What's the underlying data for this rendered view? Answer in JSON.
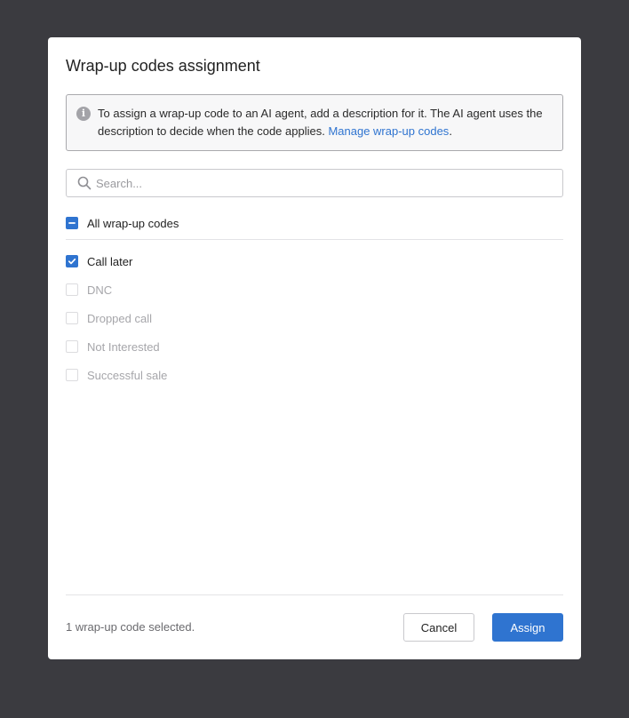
{
  "dialog": {
    "title": "Wrap-up codes assignment",
    "info": {
      "text": "To assign a wrap-up code to an AI agent, add a description for it. The AI agent uses the description to decide when the code applies. ",
      "link_label": "Manage wrap-up codes",
      "suffix": "."
    },
    "search": {
      "placeholder": "Search...",
      "value": ""
    },
    "select_all": {
      "label": "All wrap-up codes",
      "state": "indeterminate"
    },
    "codes": [
      {
        "label": "Call later",
        "checked": true,
        "enabled": true
      },
      {
        "label": "DNC",
        "checked": false,
        "enabled": false
      },
      {
        "label": "Dropped call",
        "checked": false,
        "enabled": false
      },
      {
        "label": "Not Interested",
        "checked": false,
        "enabled": false
      },
      {
        "label": "Successful sale",
        "checked": false,
        "enabled": false
      }
    ],
    "footer": {
      "status": "1 wrap-up code selected.",
      "cancel_label": "Cancel",
      "assign_label": "Assign"
    }
  },
  "colors": {
    "accent": "#2f74d0",
    "backdrop": "#3b3b40",
    "disabled_text": "#a6a6aa"
  }
}
